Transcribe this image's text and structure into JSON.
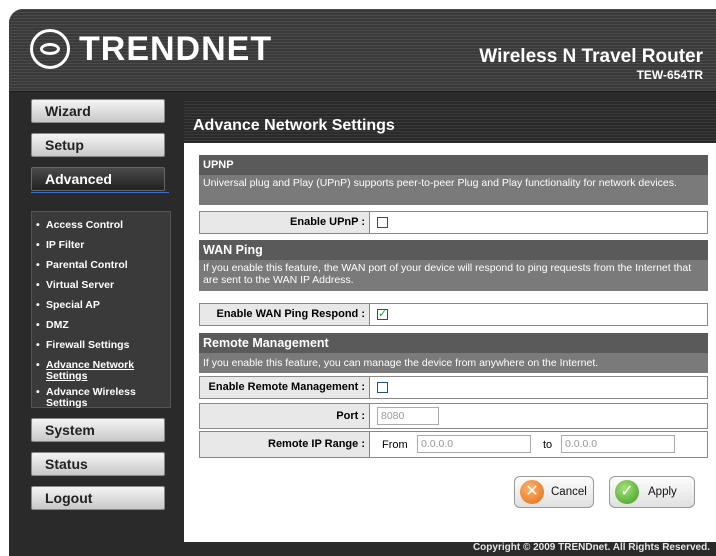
{
  "header": {
    "brand": "TRENDNET",
    "product_name": "Wireless N Travel Router",
    "product_model": "TEW-654TR"
  },
  "sidebar": {
    "menu": {
      "wizard": "Wizard",
      "setup": "Setup",
      "advanced": "Advanced",
      "system": "System",
      "status": "Status",
      "logout": "Logout"
    },
    "sub_items": [
      {
        "label": "Access Control"
      },
      {
        "label": "IP Filter"
      },
      {
        "label": "Parental Control"
      },
      {
        "label": "Virtual Server"
      },
      {
        "label": "Special AP"
      },
      {
        "label": "DMZ"
      },
      {
        "label": "Firewall Settings"
      },
      {
        "label": "Advance Network Settings"
      },
      {
        "label": "Advance Wireless Settings"
      }
    ]
  },
  "page": {
    "title": "Advance Network Settings"
  },
  "upnp": {
    "heading": "UPNP",
    "description": "Universal plug and Play (UPnP) supports peer-to-peer Plug and Play functionality for network devices.",
    "enable_label": "Enable UPnP :",
    "enabled": false
  },
  "wan_ping": {
    "heading": "WAN Ping",
    "description": "If you enable this feature, the WAN port of your device will respond to ping requests from the Internet that are sent to the WAN IP Address.",
    "enable_label": "Enable WAN Ping Respond :",
    "enabled": true
  },
  "remote": {
    "heading": "Remote Management",
    "description": "If you enable this feature, you can manage the device from anywhere on the Internet.",
    "enable_label": "Enable Remote Management :",
    "enabled": false,
    "port_label": "Port :",
    "port_value": "8080",
    "range_label": "Remote IP Range :",
    "from_text": "From",
    "from_value": "0.0.0.0",
    "to_text": "to",
    "to_value": "0.0.0.0"
  },
  "actions": {
    "cancel": "Cancel",
    "apply": "Apply"
  },
  "footer": {
    "copyright": "Copyright © 2009 TRENDnet. All Rights Reserved."
  },
  "colors": {
    "header_bg": "#3a3a3a",
    "menu_active_bg": "#222222",
    "section_head": "#5a5a5a",
    "section_desc": "#7a7a7a",
    "label_bg": "#e8e8e8",
    "accent_blue": "#3a6fd0",
    "cancel_orange": "#e36d10",
    "apply_green": "#3a9d1f"
  },
  "icons": {
    "logo": "trendnet-logo-icon",
    "cancel": "x-icon",
    "apply": "checkmark-icon"
  }
}
